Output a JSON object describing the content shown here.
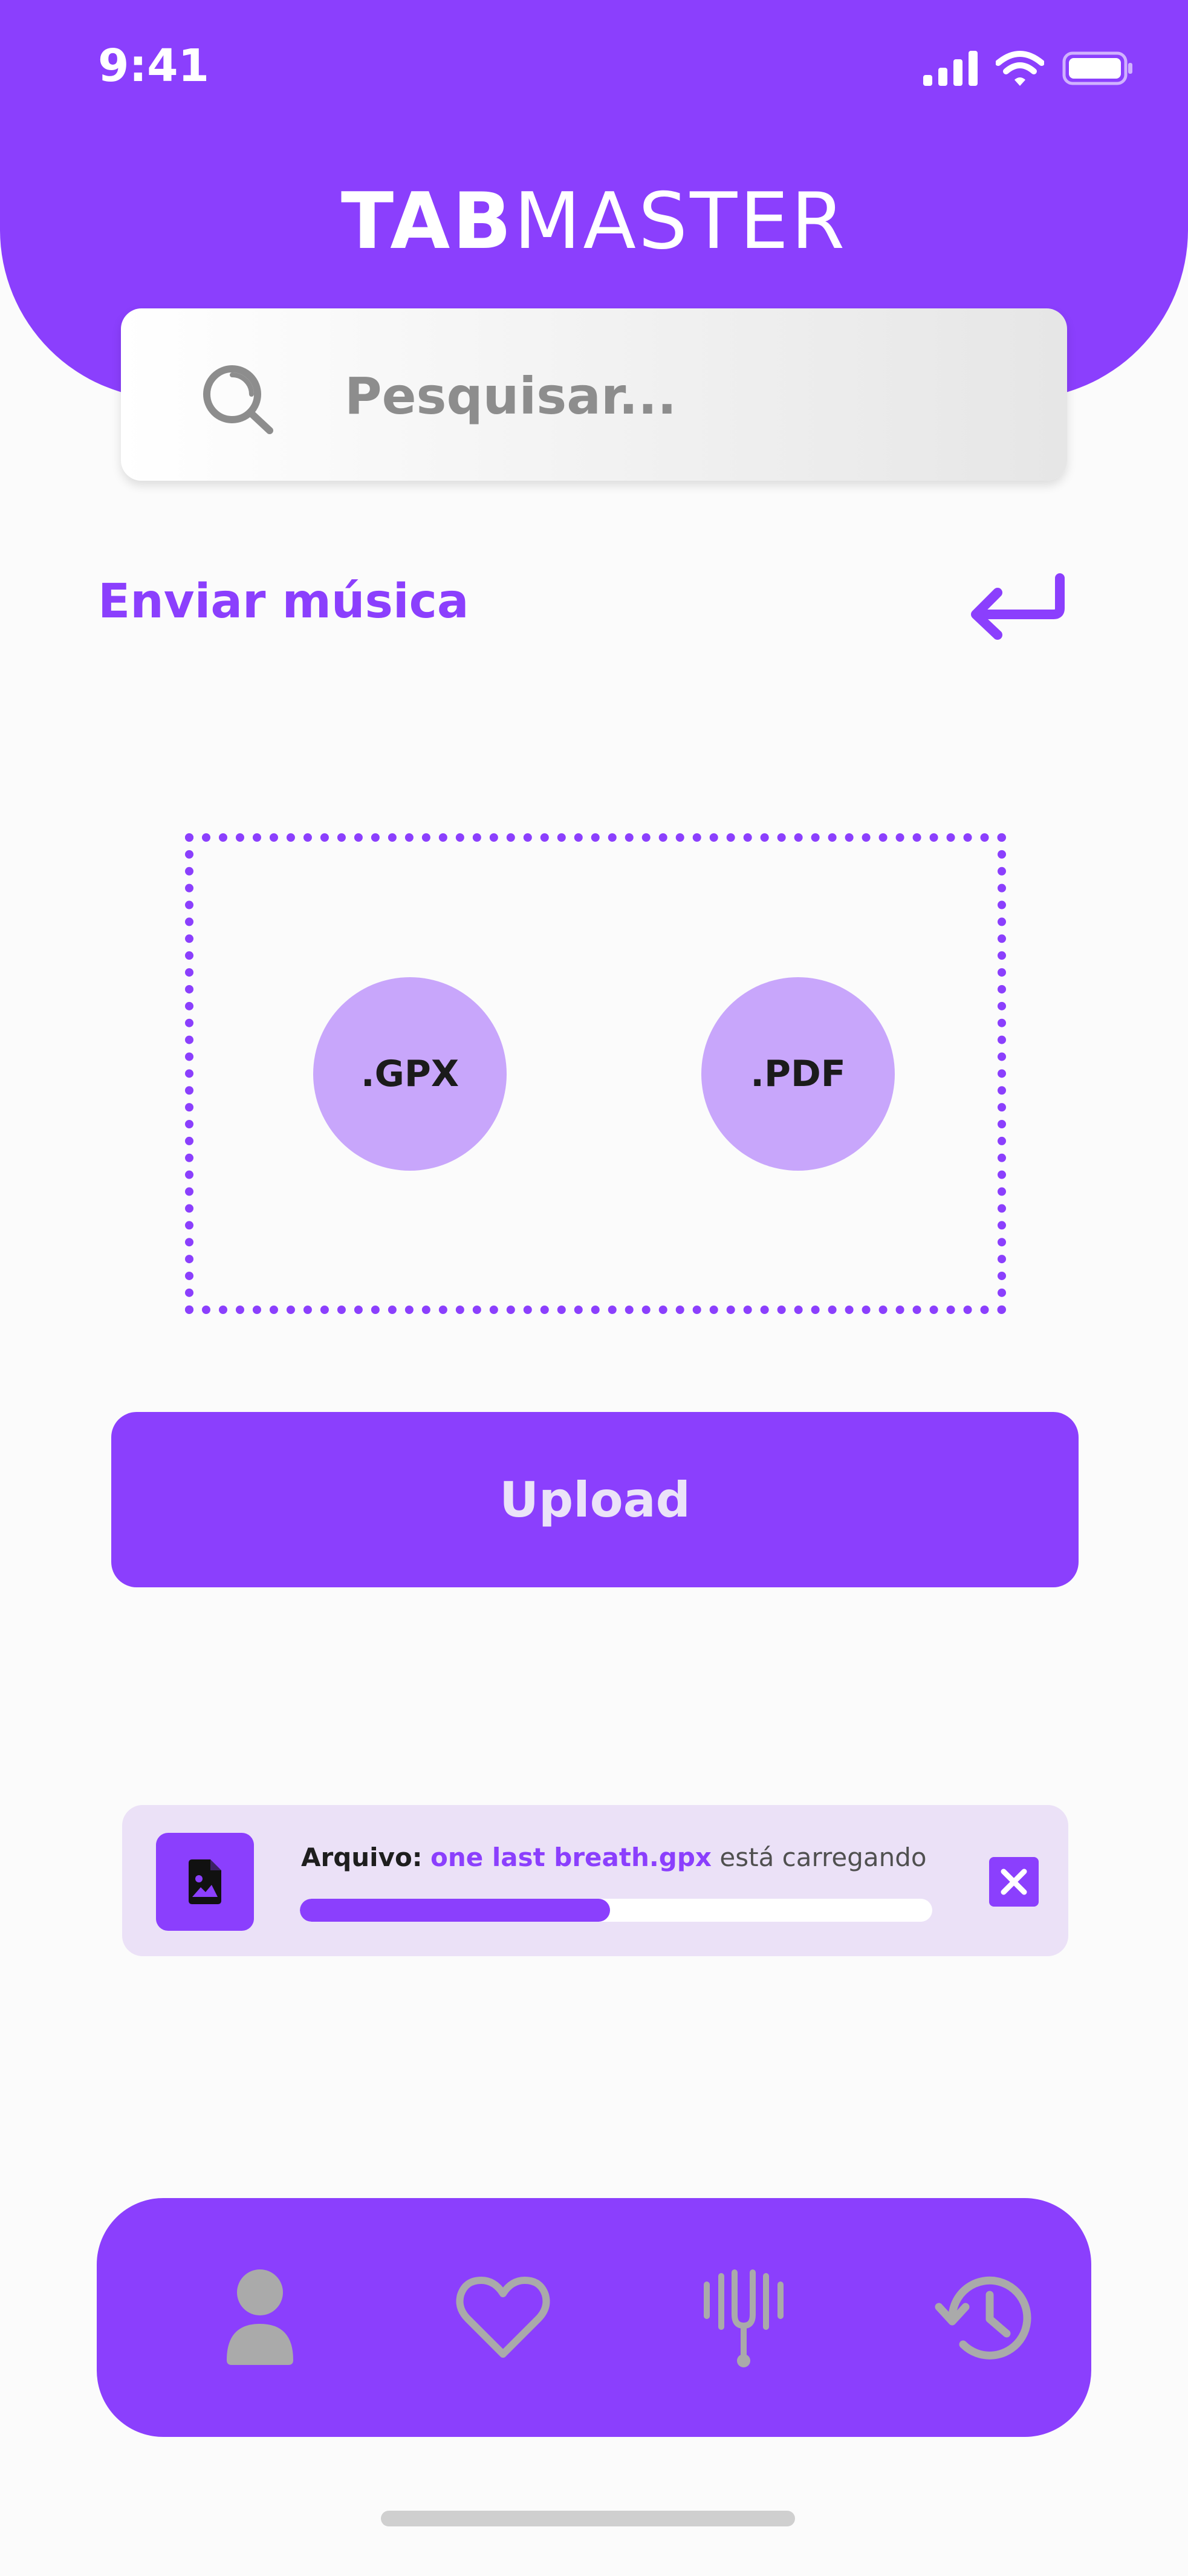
{
  "status_bar": {
    "time": "9:41",
    "icons": [
      "signal-icon",
      "wifi-icon",
      "battery-icon"
    ]
  },
  "header": {
    "brand_bold": "TAB",
    "brand_light": "MASTER"
  },
  "search": {
    "placeholder": "Pesquisar...",
    "icon": "search-icon"
  },
  "section": {
    "title": "Enviar música",
    "back_icon": "return-arrow-icon"
  },
  "dropzone": {
    "formats": [
      ".GPX",
      ".PDF"
    ]
  },
  "upload_button": {
    "label": "Upload"
  },
  "upload_status": {
    "label": "Arquivo:",
    "filename": "one last breath.gpx",
    "status_text": "está carregando",
    "progress": 0.49,
    "file_icon": "image-file-icon",
    "close_icon": "close-icon"
  },
  "bottom_nav": {
    "items": [
      "profile-icon",
      "heart-icon",
      "tuning-fork-icon",
      "history-icon"
    ]
  },
  "colors": {
    "accent": "#8b3ffd",
    "accent_light": "#c8a6fb",
    "card_bg": "#ebe1f7",
    "nav_icon": "#aaaaaa"
  }
}
